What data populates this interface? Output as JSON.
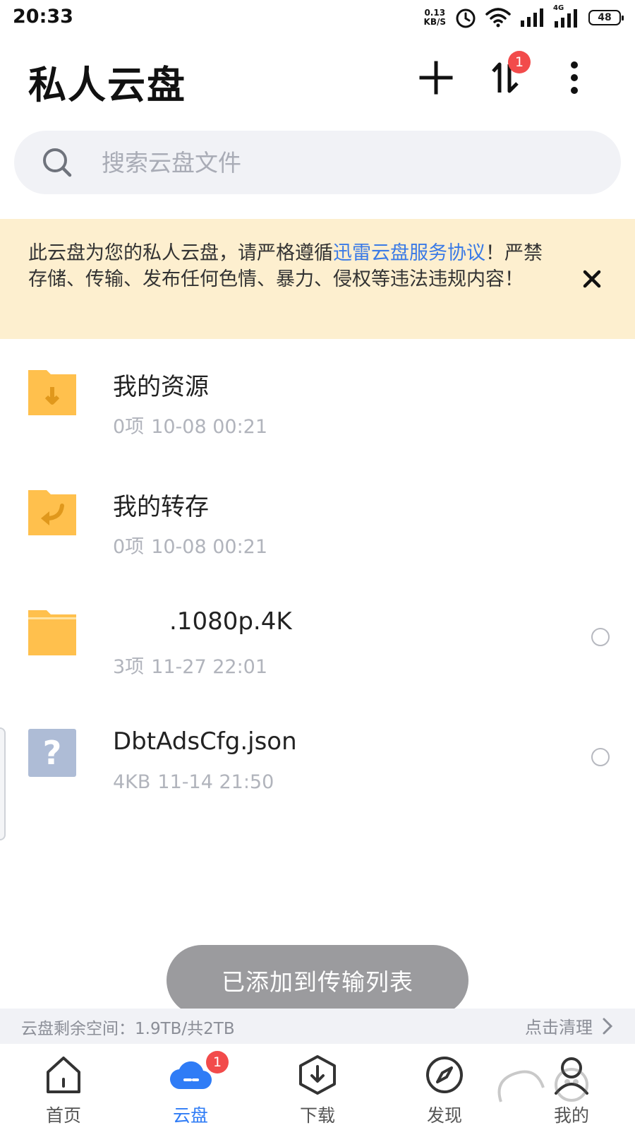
{
  "status_bar": {
    "time": "20:33",
    "net_speed_value": "0.13",
    "net_speed_unit": "KB/S",
    "network_type": "4G",
    "battery": "48"
  },
  "header": {
    "title": "私人云盘",
    "transfer_badge": "1",
    "icons": [
      "plus-icon",
      "transfer-icon",
      "more-icon"
    ]
  },
  "search": {
    "placeholder": "搜索云盘文件"
  },
  "notice": {
    "text_before": "此云盘为您的私人云盘，请严格遵循",
    "link": "迅雷云盘服务协议",
    "text_after": "！严禁存储、传输、发布任何色情、暴力、侵权等违法违规内容！"
  },
  "files": [
    {
      "name": "我的资源",
      "count": "0项",
      "date": "10-08 00:21",
      "icon": "folder-download-icon"
    },
    {
      "name": "我的转存",
      "count": "0项",
      "date": "10-08 00:21",
      "icon": "folder-transfer-icon"
    },
    {
      "name": ".1080p.4K",
      "count": "3项",
      "date": "11-27 22:01",
      "icon": "folder-icon"
    },
    {
      "name": "DbtAdsCfg.json",
      "count": "4KB",
      "date": "11-14 21:50",
      "icon": "unknown-file-icon"
    }
  ],
  "toast": {
    "message": "已添加到传输列表"
  },
  "storage": {
    "text": "云盘剩余空间：1.9TB/共2TB",
    "clean_label": "点击清理"
  },
  "tabs": [
    {
      "label": "首页",
      "icon": "home-icon"
    },
    {
      "label": "云盘",
      "icon": "cloud-icon",
      "badge": "1",
      "active": true
    },
    {
      "label": "下载",
      "icon": "download-icon"
    },
    {
      "label": "发现",
      "icon": "compass-icon"
    },
    {
      "label": "我的",
      "icon": "user-icon"
    }
  ],
  "colors": {
    "accent": "#2f7cf6",
    "badge": "#f24b4b",
    "notice_bg": "#fdefcf",
    "folder": "#ffc04d",
    "link": "#3a7ae6"
  }
}
